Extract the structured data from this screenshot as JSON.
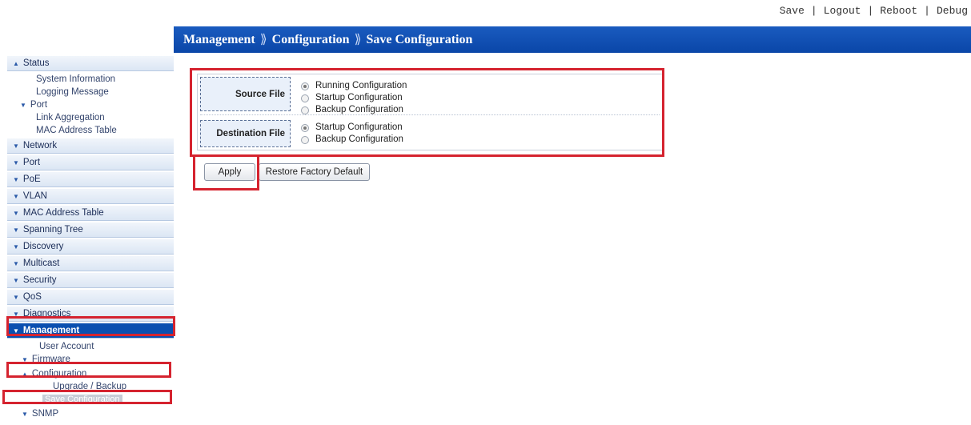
{
  "toplinks": {
    "save": "Save",
    "logout": "Logout",
    "reboot": "Reboot",
    "debug": "Debug",
    "separator": "|"
  },
  "breadcrumb": {
    "items": [
      "Management",
      "Configuration",
      "Save Configuration"
    ],
    "separator": "⟫"
  },
  "sidebar": {
    "status": "Status",
    "system_information": "System Information",
    "logging_message": "Logging Message",
    "port_sub": "Port",
    "link_aggregation": "Link Aggregation",
    "mac_address_table_sub": "MAC Address Table",
    "network": "Network",
    "port": "Port",
    "poe": "PoE",
    "vlan": "VLAN",
    "mac_address_table": "MAC Address Table",
    "spanning_tree": "Spanning Tree",
    "discovery": "Discovery",
    "multicast": "Multicast",
    "security": "Security",
    "qos": "QoS",
    "diagnostics": "Diagnostics",
    "management": "Management",
    "user_account": "User Account",
    "firmware": "Firmware",
    "configuration": "Configuration",
    "upgrade_backup": "Upgrade / Backup",
    "save_configuration": "Save Configuration",
    "snmp": "SNMP"
  },
  "form": {
    "source_label": "Source File",
    "source_options": [
      "Running Configuration",
      "Startup Configuration",
      "Backup Configuration"
    ],
    "source_selected": "Running Configuration",
    "destination_label": "Destination File",
    "destination_options": [
      "Startup Configuration",
      "Backup Configuration"
    ],
    "destination_selected": "Startup Configuration"
  },
  "buttons": {
    "apply": "Apply",
    "restore": "Restore Factory Default"
  },
  "colors": {
    "titlebar": "#0a46a8",
    "active_menu": "#0a4fb0",
    "highlight": "#d5232f"
  }
}
